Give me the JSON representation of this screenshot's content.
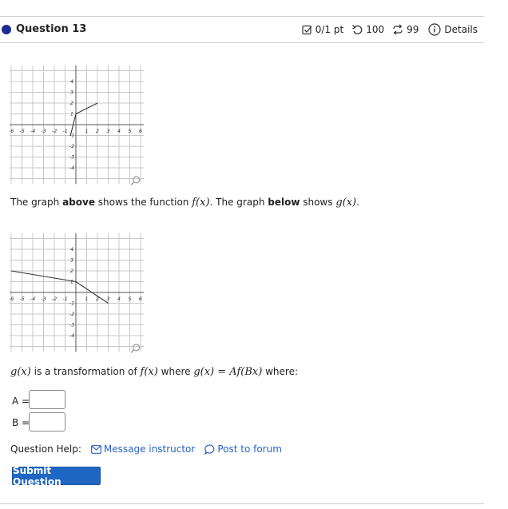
{
  "header": {
    "question_title": "Question 13",
    "score": "0/1 pt",
    "retries": "100",
    "attempts": "99",
    "details_label": "Details",
    "score_icon": "checkbox-icon",
    "retry_icon": "undo-icon",
    "attempt_icon": "repeat-icon",
    "details_icon": "info-icon"
  },
  "graph_top": {
    "x_ticks": [
      "-6",
      "-5",
      "-4",
      "-3",
      "-2",
      "-1",
      "1",
      "2",
      "3",
      "4",
      "5",
      "6"
    ],
    "y_ticks": [
      "4",
      "3",
      "2",
      "1",
      "-1",
      "-2",
      "-3",
      "-4"
    ],
    "polyline": [
      [
        -0.5,
        -1
      ],
      [
        0,
        1
      ],
      [
        2,
        2
      ]
    ],
    "zoom_icon": "magnifier-icon"
  },
  "graph_bottom": {
    "x_ticks": [
      "-6",
      "-5",
      "-4",
      "-3",
      "-2",
      "-1",
      "1",
      "2",
      "3",
      "4",
      "5",
      "6"
    ],
    "y_ticks": [
      "4",
      "3",
      "2",
      "1",
      "-1",
      "-2",
      "-3",
      "-4"
    ],
    "polyline": [
      [
        -6,
        2
      ],
      [
        0,
        1
      ],
      [
        3,
        -1
      ]
    ],
    "zoom_icon": "magnifier-icon"
  },
  "text": {
    "line1_a": "The graph ",
    "line1_b": "above",
    "line1_c": " shows the function ",
    "line1_f": "f(x)",
    "line1_d": ". The graph ",
    "line1_e": "below",
    "line1_g": " shows ",
    "line1_gx": "g(x)",
    "line1_end": ".",
    "line2_g": "g(x)",
    "line2_a": " is a transformation of ",
    "line2_f": "f(x)",
    "line2_b": " where ",
    "line2_eq": "g(x) = Af(Bx)",
    "line2_c": " where:"
  },
  "form": {
    "a_label": "A =",
    "b_label": "B =",
    "a_value": "",
    "b_value": ""
  },
  "help": {
    "label": "Question Help:",
    "message_link": "Message instructor",
    "forum_link": "Post to forum",
    "message_icon": "envelope-icon",
    "forum_icon": "speech-bubble-icon"
  },
  "submit_label": "Submit Question"
}
